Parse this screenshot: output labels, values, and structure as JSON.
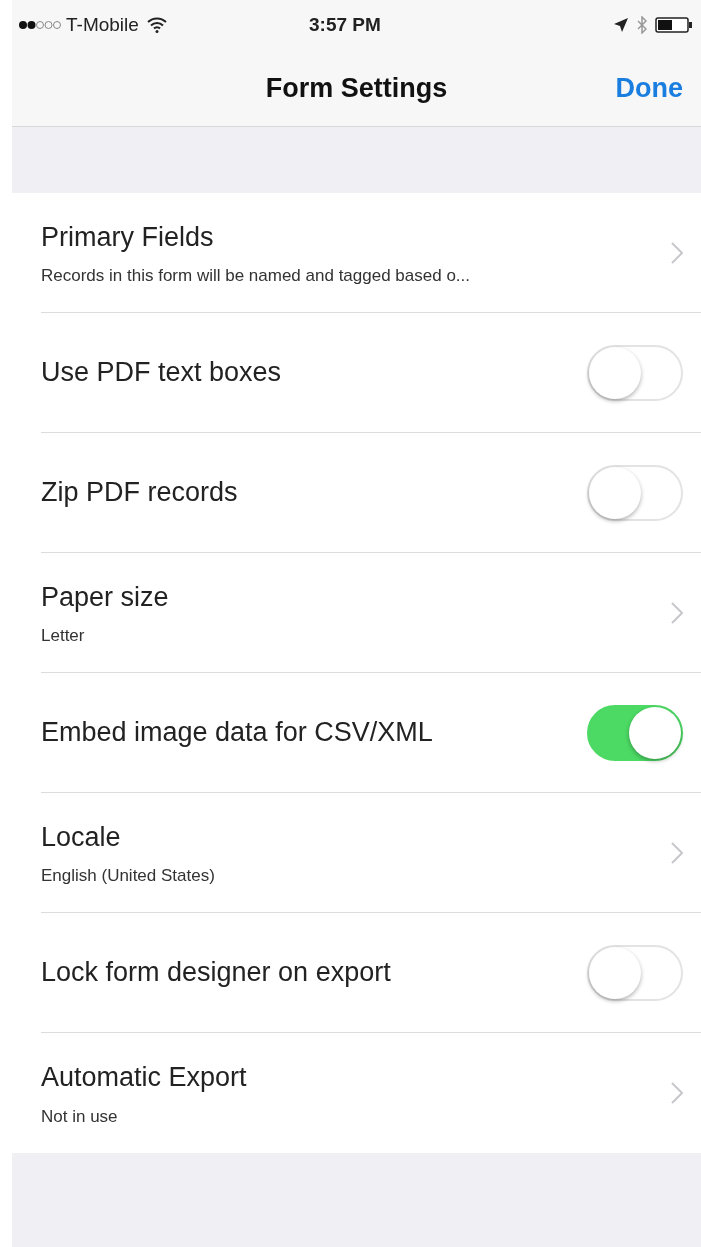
{
  "status_bar": {
    "carrier": "T-Mobile",
    "time": "3:57 PM"
  },
  "nav_bar": {
    "title": "Form Settings",
    "done": "Done"
  },
  "settings": [
    {
      "kind": "detail",
      "label": "Primary Fields",
      "detail": "Records in this form will be named and tagged based o..."
    },
    {
      "kind": "toggle",
      "label": "Use PDF text boxes",
      "on": false
    },
    {
      "kind": "toggle",
      "label": "Zip PDF records",
      "on": false
    },
    {
      "kind": "detail",
      "label": "Paper size",
      "detail": "Letter"
    },
    {
      "kind": "toggle",
      "label": "Embed image data for CSV/XML",
      "on": true
    },
    {
      "kind": "detail",
      "label": "Locale",
      "detail": "English (United States)"
    },
    {
      "kind": "toggle",
      "label": "Lock form designer on export",
      "on": false
    },
    {
      "kind": "detail",
      "label": "Automatic Export",
      "detail": "Not in use"
    }
  ]
}
